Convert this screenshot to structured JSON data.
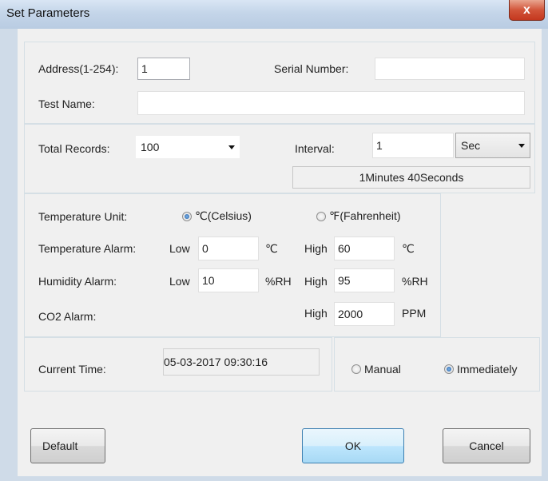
{
  "window": {
    "title": "Set Parameters",
    "close_glyph": "x"
  },
  "device": {
    "address_label": "Address(1-254):",
    "address_value": "1",
    "serial_label": "Serial Number:",
    "serial_value": "",
    "test_name_label": "Test Name:",
    "test_name_value": ""
  },
  "records": {
    "total_label": "Total Records:",
    "total_value": "100",
    "interval_label": "Interval:",
    "interval_value": "1",
    "interval_unit": "Sec",
    "duration_readout": "1Minutes 40Seconds"
  },
  "alarms": {
    "temp_unit_label": "Temperature Unit:",
    "celsius_label": "℃(Celsius)",
    "fahrenheit_label": "℉(Fahrenheit)",
    "selected_unit": "celsius",
    "temp_alarm_label": "Temperature Alarm:",
    "humidity_alarm_label": "Humidity Alarm:",
    "co2_alarm_label": "CO2 Alarm:",
    "low_label": "Low",
    "high_label": "High",
    "temp_low": "0",
    "temp_high": "60",
    "temp_unit_symbol": "℃",
    "hum_low": "10",
    "hum_high": "95",
    "hum_unit_symbol": "%RH",
    "co2_high": "2000",
    "co2_unit_symbol": "PPM"
  },
  "time": {
    "current_time_label": "Current Time:",
    "current_time_value": "05-03-2017 09:30:16",
    "manual_label": "Manual",
    "immediately_label": "Immediately",
    "selected_mode": "immediately"
  },
  "buttons": {
    "default_label": "Default",
    "ok_label": "OK",
    "cancel_label": "Cancel"
  },
  "colors": {
    "accent": "#3c7fb1",
    "titlebar": "#c4d5e9",
    "close": "#c4371e",
    "client_bg": "#f0f0f0"
  }
}
